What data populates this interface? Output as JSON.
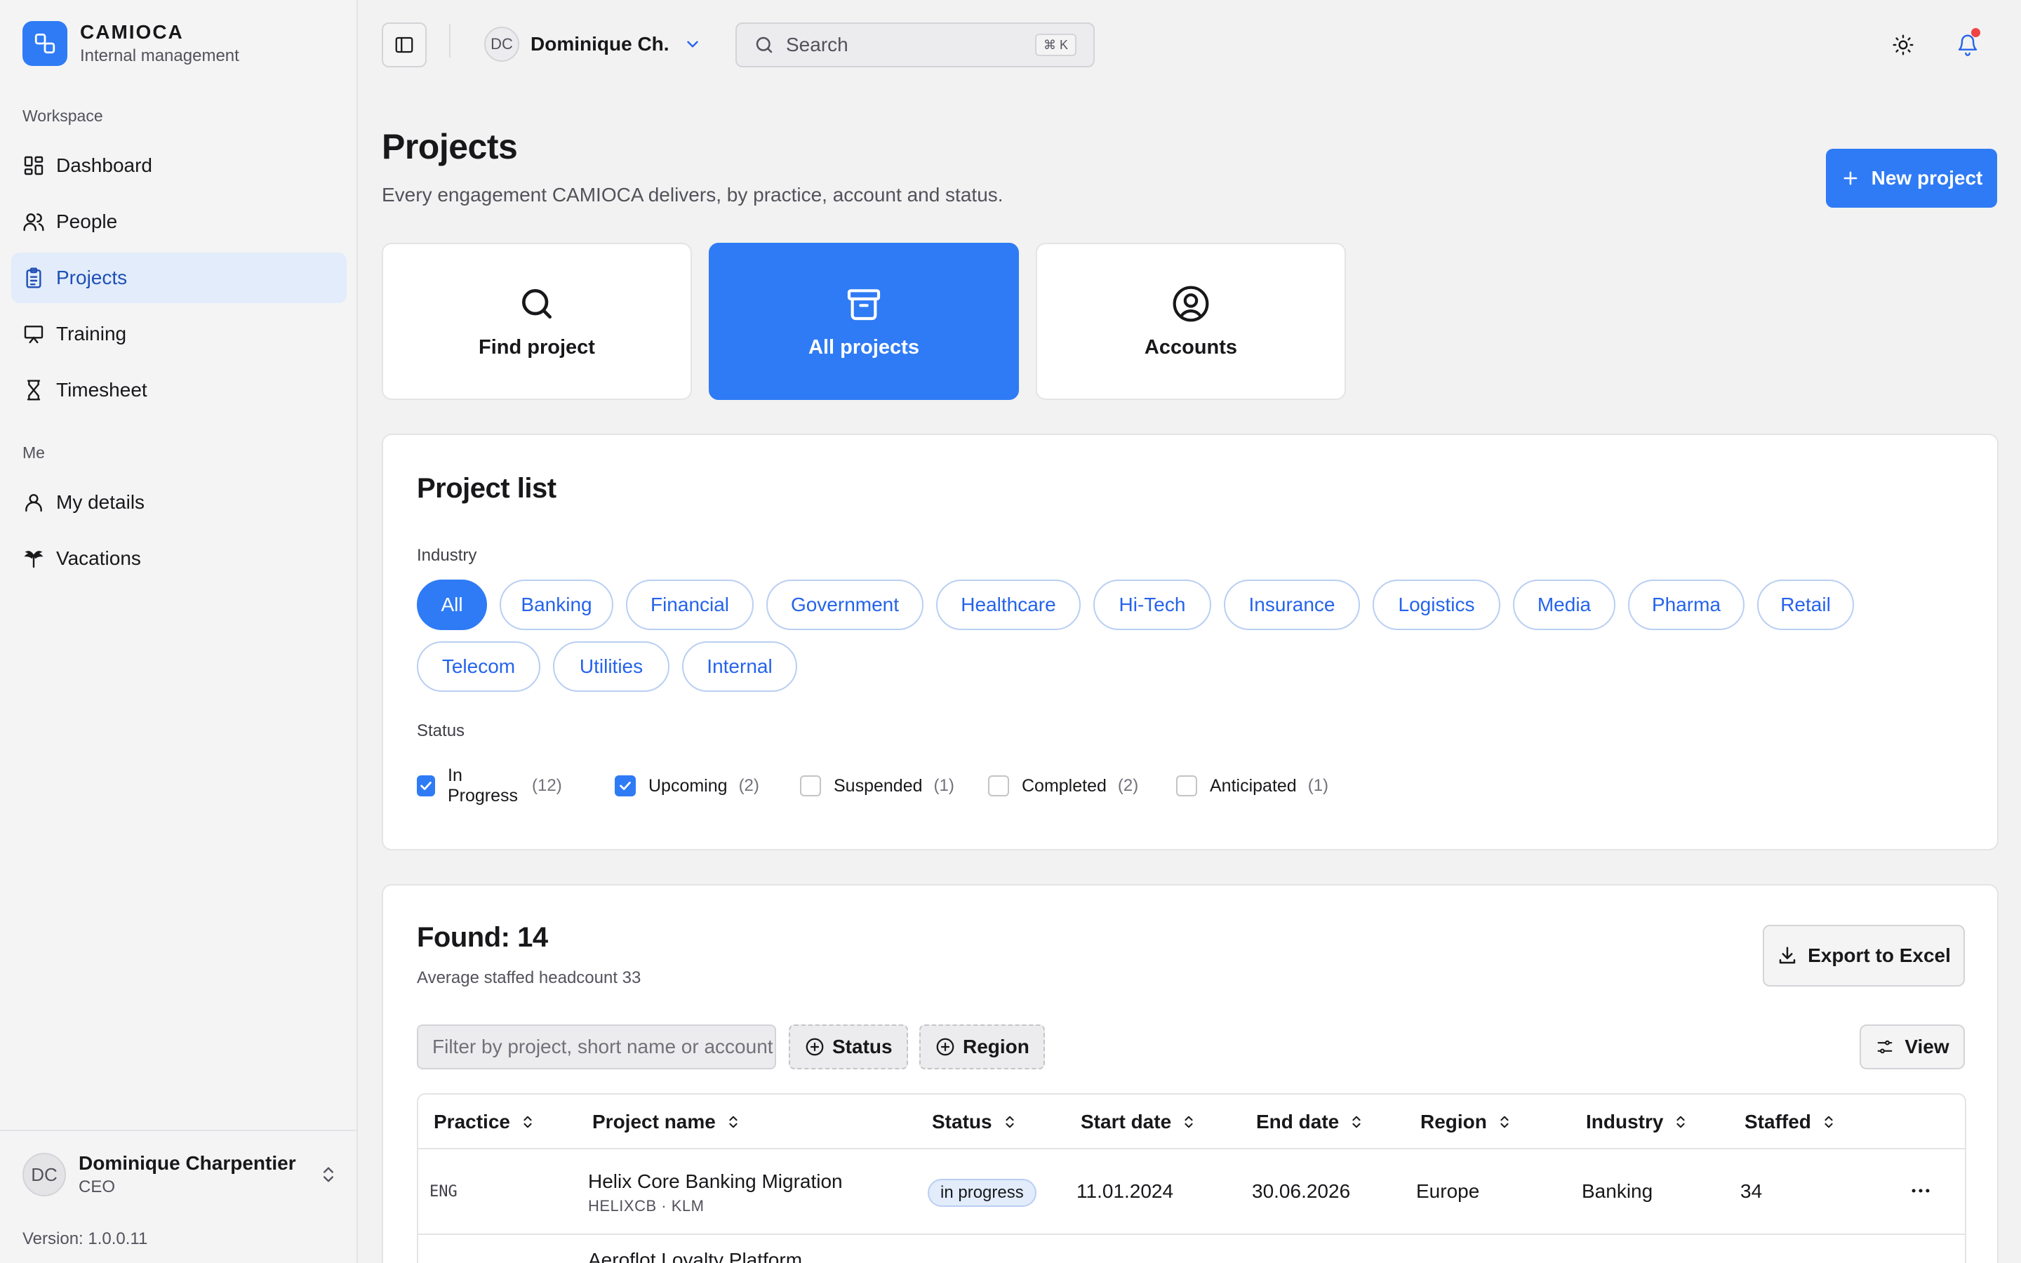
{
  "brand": {
    "name": "CAMIOCA",
    "subtitle": "Internal management"
  },
  "sidebar": {
    "sections": [
      {
        "label": "Workspace"
      },
      {
        "label": "Me"
      }
    ],
    "items": [
      {
        "label": "Dashboard",
        "icon": "dashboard-icon"
      },
      {
        "label": "People",
        "icon": "people-icon"
      },
      {
        "label": "Projects",
        "icon": "clipboard-icon",
        "active": true
      },
      {
        "label": "Training",
        "icon": "presentation-icon"
      },
      {
        "label": "Timesheet",
        "icon": "hourglass-icon"
      },
      {
        "label": "My details",
        "icon": "user-icon"
      },
      {
        "label": "Vacations",
        "icon": "palm-tree-icon"
      }
    ],
    "footer": {
      "initials": "DC",
      "name": "Dominique Charpentier",
      "role": "CEO",
      "version": "Version: 1.0.0.11"
    }
  },
  "topbar": {
    "user": {
      "initials": "DC",
      "name": "Dominique Ch."
    },
    "search": {
      "placeholder": "Search",
      "shortcut": "⌘ K"
    },
    "notification_dot": true
  },
  "page": {
    "title": "Projects",
    "subtitle": "Every engagement CAMIOCA delivers, by practice, account and status.",
    "new_button": "New project"
  },
  "tiles": [
    {
      "label": "Find project",
      "icon": "search-icon"
    },
    {
      "label": "All projects",
      "icon": "archive-icon",
      "active": true
    },
    {
      "label": "Accounts",
      "icon": "user-circle-icon"
    }
  ],
  "project_list": {
    "title": "Project list",
    "industry_label": "Industry",
    "industries": [
      "All",
      "Banking",
      "Financial",
      "Government",
      "Healthcare",
      "Hi-Tech",
      "Insurance",
      "Logistics",
      "Media",
      "Pharma",
      "Retail",
      "Telecom",
      "Utilities",
      "Internal"
    ],
    "active_industry": "All",
    "status_label": "Status",
    "statuses": [
      {
        "label": "In Progress",
        "count": "(12)",
        "checked": true
      },
      {
        "label": "Upcoming",
        "count": "(2)",
        "checked": true
      },
      {
        "label": "Suspended",
        "count": "(1)",
        "checked": false
      },
      {
        "label": "Completed",
        "count": "(2)",
        "checked": false
      },
      {
        "label": "Anticipated",
        "count": "(1)",
        "checked": false
      }
    ]
  },
  "results": {
    "title": "Found: 14",
    "subtitle": "Average staffed headcount 33",
    "export_button": "Export to Excel",
    "filter_placeholder": "Filter by project, short name or account",
    "status_filter": "Status",
    "region_filter": "Region",
    "view_button": "View",
    "columns": [
      "Practice",
      "Project name",
      "Status",
      "Start date",
      "End date",
      "Region",
      "Industry",
      "Staffed"
    ],
    "rows": [
      {
        "practice": "ENG",
        "name": "Helix Core Banking Migration",
        "short": "HELIXCB · KLM",
        "status": "in progress",
        "start": "11.01.2024",
        "end": "30.06.2026",
        "region": "Europe",
        "industry": "Banking",
        "staffed": "34"
      },
      {
        "name": "Aeroflot Loyalty Platform"
      }
    ]
  }
}
